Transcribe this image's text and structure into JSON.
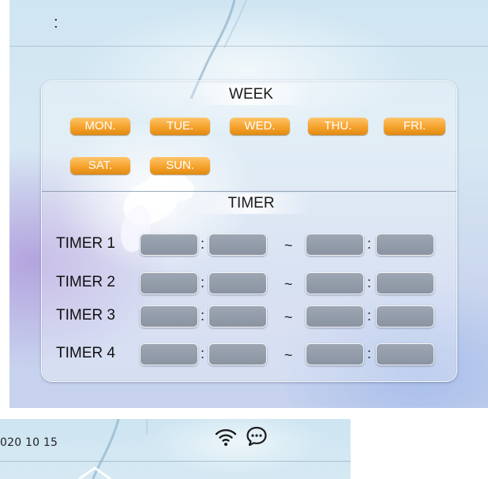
{
  "header": {
    "title": ":"
  },
  "week": {
    "title": "WEEK",
    "days": [
      "MON.",
      "TUE.",
      "WED.",
      "THU.",
      "FRI.",
      "SAT.",
      "SUN."
    ],
    "button_color": "#f5a22c"
  },
  "timer": {
    "title": "TIMER",
    "rows": [
      {
        "label": "TIMER 1",
        "start_sep": ":",
        "range_sep": "~",
        "end_sep": ":"
      },
      {
        "label": "TIMER 2",
        "start_sep": ":",
        "range_sep": "~",
        "end_sep": ":"
      },
      {
        "label": "TIMER 3",
        "start_sep": ":",
        "range_sep": "~",
        "end_sep": ":"
      },
      {
        "label": "TIMER 4",
        "start_sep": ":",
        "range_sep": "~",
        "end_sep": ":"
      }
    ],
    "field_color": "#8f98a5"
  },
  "status_bar": {
    "date": "020 10 15",
    "icons": [
      "wifi-icon",
      "chat-icon"
    ]
  }
}
